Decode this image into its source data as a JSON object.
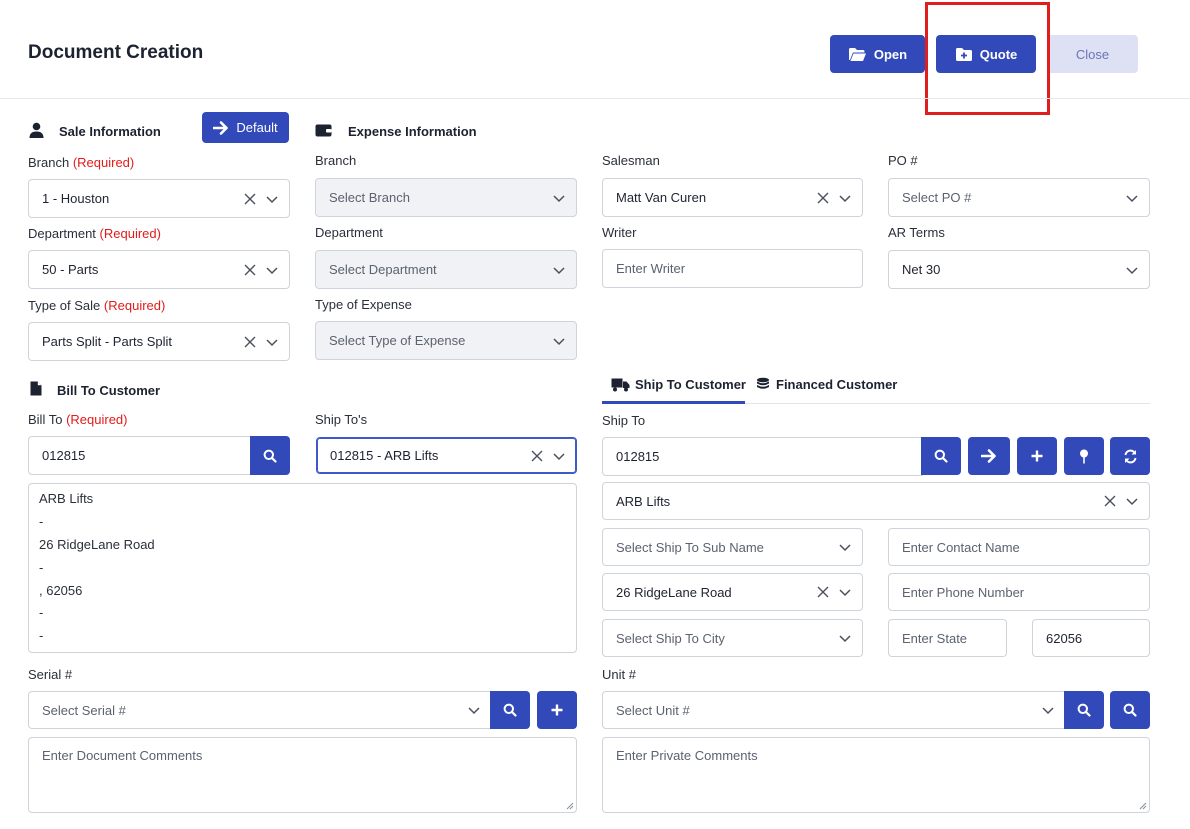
{
  "header": {
    "title": "Document Creation",
    "open_label": "Open",
    "quote_label": "Quote",
    "close_label": "Close"
  },
  "sale_info": {
    "title": "Sale Information",
    "default_label": "Default",
    "branch_label": "Branch",
    "department_label": "Department",
    "type_of_sale_label": "Type of Sale",
    "required": "(Required)",
    "branch_value": "1 - Houston",
    "department_value": "50 - Parts",
    "type_of_sale_value": "Parts Split - Parts Split"
  },
  "expense_info": {
    "title": "Expense Information",
    "branch_label": "Branch",
    "branch_placeholder": "Select Branch",
    "department_label": "Department",
    "department_placeholder": "Select Department",
    "type_label": "Type of Expense",
    "type_placeholder": "Select Type of Expense"
  },
  "right_fields": {
    "salesman_label": "Salesman",
    "salesman_value": "Matt Van Curen",
    "po_label": "PO #",
    "po_placeholder": "Select PO #",
    "writer_label": "Writer",
    "writer_placeholder": "Enter Writer",
    "ar_terms_label": "AR Terms",
    "ar_terms_value": "Net 30"
  },
  "bill_to": {
    "title": "Bill To Customer",
    "label": "Bill To",
    "required": "(Required)",
    "value": "012815",
    "ship_tos_label": "Ship To's",
    "ship_tos_value": "012815 - ARB Lifts",
    "address_lines": [
      "ARB Lifts",
      "-",
      "26 RidgeLane Road",
      "-",
      ", 62056",
      "-",
      "-"
    ]
  },
  "ship_tabs": {
    "ship_to_customer": "Ship To Customer",
    "financed_customer": "Financed Customer"
  },
  "ship_to": {
    "label": "Ship To",
    "value": "012815",
    "name_value": "ARB Lifts",
    "sub_name_placeholder": "Select Ship To Sub Name",
    "contact_placeholder": "Enter Contact Name",
    "address_value": "26 RidgeLane Road",
    "phone_placeholder": "Enter Phone Number",
    "city_placeholder": "Select Ship To City",
    "state_placeholder": "Enter State",
    "zip_value": "62056"
  },
  "serial": {
    "label": "Serial #",
    "placeholder": "Select Serial #"
  },
  "unit": {
    "label": "Unit #",
    "placeholder": "Select Unit #"
  },
  "comments": {
    "document_placeholder": "Enter Document Comments",
    "private_placeholder": "Enter Private Comments"
  },
  "colors": {
    "primary": "#3249b9",
    "light_button": "#dde1f3",
    "required": "#e21b1b",
    "highlight": "#e01e1e"
  }
}
